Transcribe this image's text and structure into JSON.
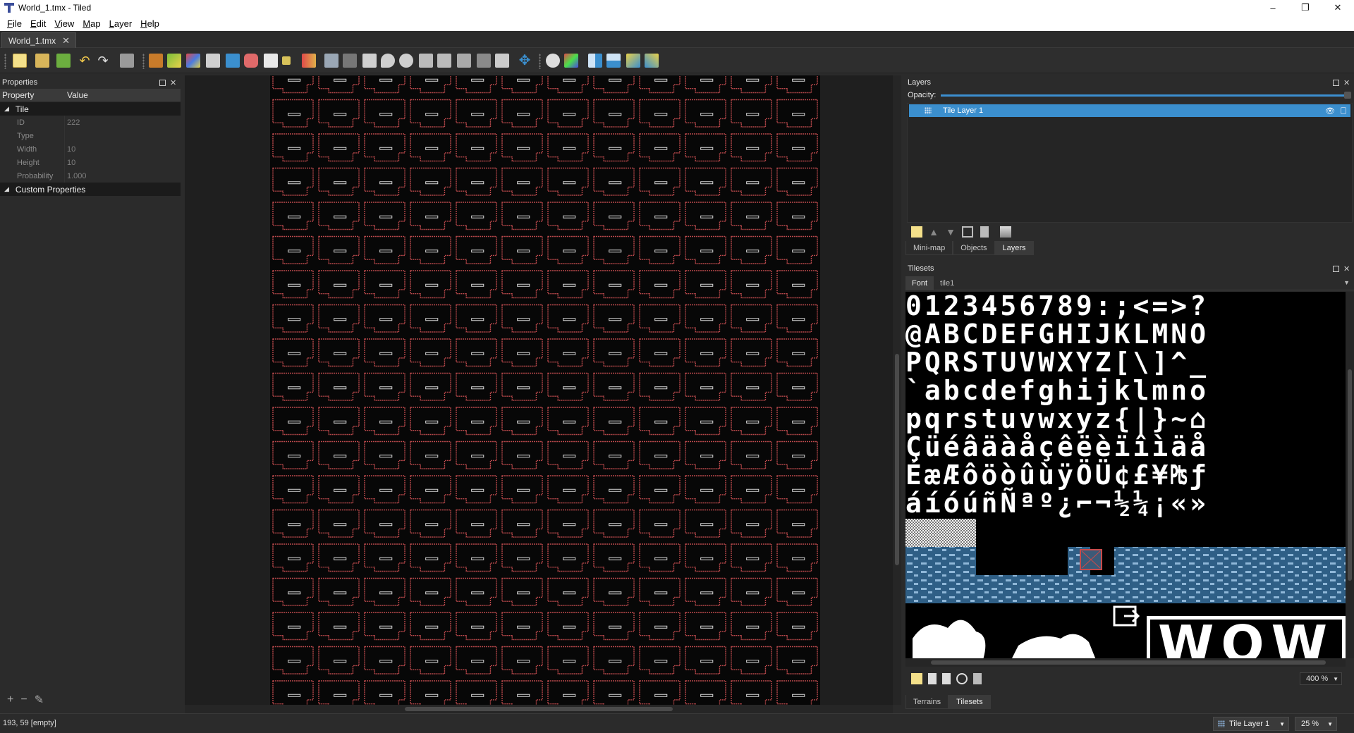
{
  "window": {
    "title": "World_1.tmx - Tiled",
    "minimize": "–",
    "maximize": "❐",
    "close": "✕"
  },
  "menu": [
    "File",
    "Edit",
    "View",
    "Map",
    "Layer",
    "Help"
  ],
  "document_tab": {
    "label": "World_1.tmx",
    "close": "✕"
  },
  "properties": {
    "title": "Properties",
    "col_property": "Property",
    "col_value": "Value",
    "group_tile": "Tile",
    "rows": [
      {
        "key": "ID",
        "value": "222"
      },
      {
        "key": "Type",
        "value": ""
      },
      {
        "key": "Width",
        "value": "10"
      },
      {
        "key": "Height",
        "value": "10"
      },
      {
        "key": "Probability",
        "value": "1.000"
      }
    ],
    "group_custom": "Custom Properties",
    "add": "+",
    "remove": "−",
    "edit": "✎"
  },
  "layers": {
    "title": "Layers",
    "opacity_label": "Opacity:",
    "opacity": 1.0,
    "items": [
      {
        "name": "Tile Layer 1",
        "visible": true
      }
    ],
    "eye": "👁",
    "tabs": [
      "Mini-map",
      "Objects",
      "Layers"
    ],
    "active_tab": "Layers"
  },
  "tilesets": {
    "title": "Tilesets",
    "tabs": [
      "Font",
      "tile1"
    ],
    "active_tab": "Font",
    "glyph_rows": [
      "0123456789:;<=>?",
      "@ABCDEFGHIJKLMNO",
      "PQRSTUVWXYZ[\\]^_",
      "`abcdefghijklmno",
      "pqrstuvwxyz{|}~⌂",
      "Çüéâäàåçêëèïîìäå",
      "ÉæÆôöòûùÿÖÜ¢£¥₧ƒ",
      "áíóúñÑªº¿⌐¬½¼¡«»"
    ],
    "wow_text": "WOW",
    "zoom": "400 %",
    "bottom_tabs": [
      "Terrains",
      "Tilesets"
    ],
    "active_bottom_tab": "Tilesets"
  },
  "status": {
    "cursor": "193, 59 [empty]",
    "layer": "Tile Layer 1",
    "zoom": "25 %"
  },
  "colors": {
    "accent": "#3b8fce",
    "map_outline": "#b8484b",
    "panel_bg": "#2b2b2b",
    "water": "#2f5f86"
  }
}
